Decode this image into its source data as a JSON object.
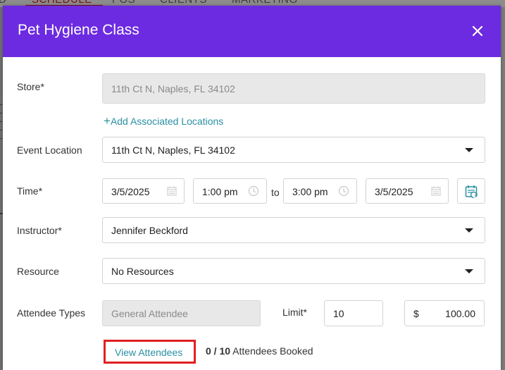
{
  "background": {
    "nav_items": [
      "D",
      "SCHEDULE",
      "POS",
      "CLIENTS",
      "MARKETING"
    ]
  },
  "modal": {
    "title": "Pet Hygiene Class",
    "colors": {
      "header": "#6c2be0",
      "link": "#2a8fa3",
      "highlight": "#e02020"
    }
  },
  "store": {
    "label": "Store*",
    "value": "11th Ct N, Naples, FL 34102"
  },
  "add_locations": {
    "label": "Add Associated Locations"
  },
  "event_location": {
    "label": "Event Location",
    "value": "11th Ct N, Naples, FL 34102"
  },
  "time": {
    "label": "Time*",
    "start_date": "3/5/2025",
    "start_time": "1:00 pm",
    "to": "to",
    "end_time": "3:00 pm",
    "end_date": "3/5/2025"
  },
  "instructor": {
    "label": "Instructor*",
    "value": "Jennifer Beckford"
  },
  "resource": {
    "label": "Resource",
    "value": "No Resources"
  },
  "attendee_types": {
    "label": "Attendee Types",
    "value": "General Attendee"
  },
  "limit": {
    "label": "Limit*",
    "value": "10"
  },
  "price": {
    "currency": "$",
    "value": "100.00"
  },
  "attendees": {
    "view_label": "View Attendees",
    "booked": "0",
    "separator": " / ",
    "capacity": "10",
    "suffix": " Attendees Booked"
  }
}
